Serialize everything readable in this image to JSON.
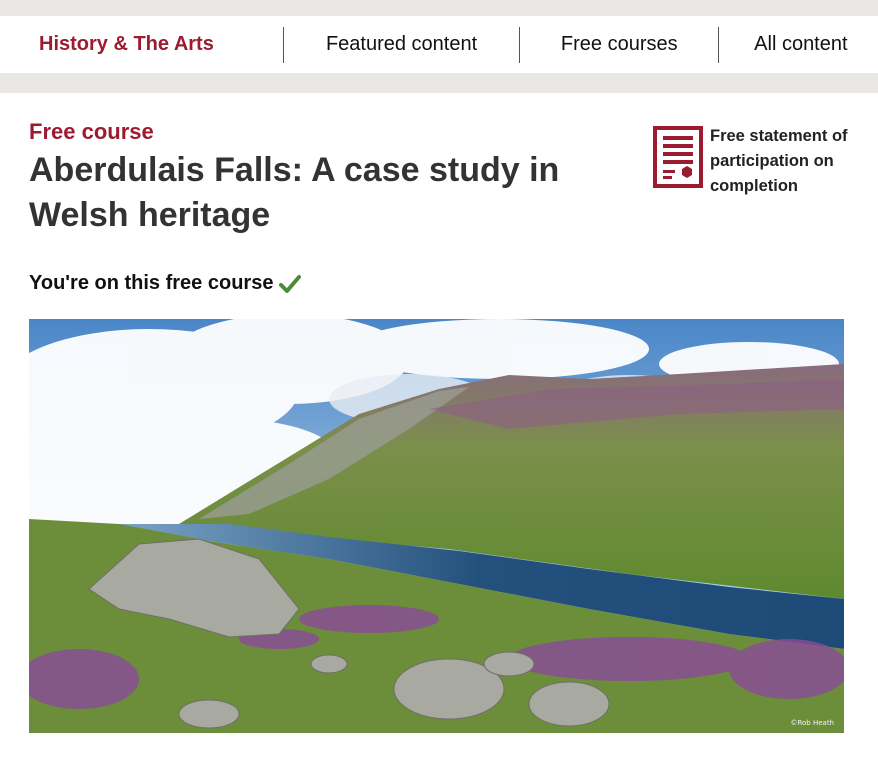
{
  "nav": {
    "brand": "History & The Arts",
    "items": [
      {
        "label": "Featured content"
      },
      {
        "label": "Free courses"
      },
      {
        "label": "All content"
      }
    ]
  },
  "course": {
    "kicker": "Free course",
    "title": "Aberdulais Falls: A case study in Welsh heritage",
    "certificate": "Free statement of participation on completion",
    "enrolled_status": "You're on this free course"
  },
  "hero": {
    "photo_credit": "©Rob Heath"
  },
  "colors": {
    "brand": "#9b1b30",
    "check": "#4f8a3a",
    "nav_strip": "#e9e7e3"
  },
  "icons": {
    "certificate": "certificate-icon",
    "enrolled": "check-icon"
  }
}
